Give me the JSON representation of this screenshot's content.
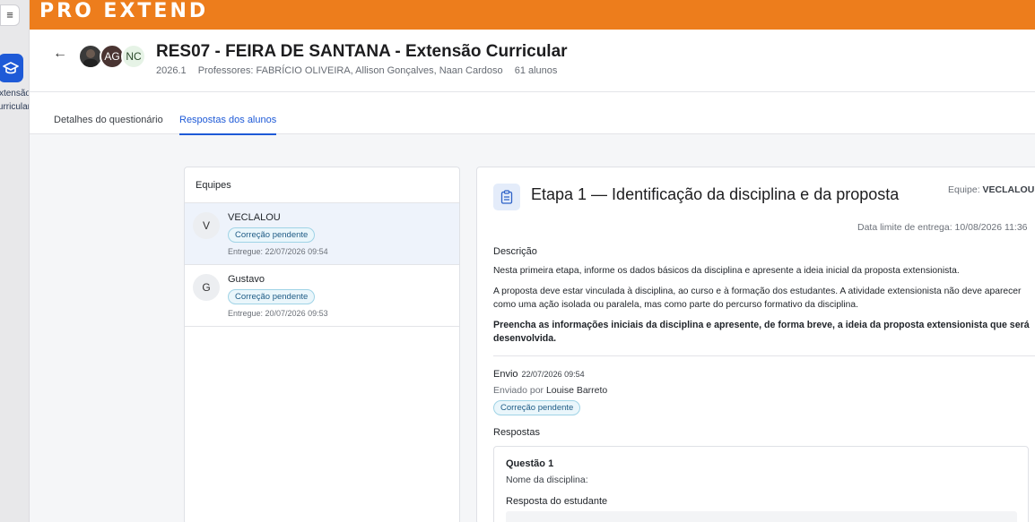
{
  "rail": {
    "menu_icon": "hamburger-icon",
    "app_icon": "graduation-cap-icon",
    "app_label": "Extensão Curricular"
  },
  "brand": {
    "logo_text": "PRO EXTEND",
    "color": "#ed7d1c"
  },
  "course": {
    "title": "RES07 - FEIRA DE SANTANA - Extensão Curricular",
    "term": "2026.1",
    "professors": "Professores: FABRÍCIO OLIVEIRA, Allison Gonçalves, Naan Cardoso",
    "students": "61 alunos",
    "avatars": [
      "",
      "AG",
      "NC"
    ]
  },
  "tabs": [
    {
      "label": "Detalhes do questionário",
      "active": false
    },
    {
      "label": "Respostas dos alunos",
      "active": true
    }
  ],
  "teams": {
    "title": "Equipes",
    "items": [
      {
        "initial": "V",
        "name": "VECLALOU",
        "status": "Correção pendente",
        "delivered": "Entregue: 22/07/2026 09:54",
        "selected": true
      },
      {
        "initial": "G",
        "name": "Gustavo",
        "status": "Correção pendente",
        "delivered": "Entregue: 20/07/2026 09:53",
        "selected": false
      }
    ]
  },
  "detail": {
    "stage_title": "Etapa 1 — Identificação da disciplina e da proposta",
    "team_label": "Equipe:",
    "team_name": "VECLALOU",
    "deadline": "Data limite de entrega: 10/08/2026 11:36",
    "description_heading": "Descrição",
    "paragraph1": "Nesta primeira etapa, informe os dados básicos da disciplina e apresente a ideia inicial da proposta extensionista.",
    "paragraph2": "A proposta deve estar vinculada à disciplina, ao curso e à formação dos estudantes. A atividade extensionista não deve aparecer como uma ação isolada ou paralela, mas como parte do percurso formativo da disciplina.",
    "paragraph3": "Preencha as informações iniciais da disciplina e apresente, de forma breve, a ideia da proposta extensionista que será desenvolvida.",
    "submission_label": "Envio",
    "submission_date": "22/07/2026 09:54",
    "sent_by_label": "Enviado por",
    "sent_by": "Louise Barreto",
    "status": "Correção pendente",
    "answers_heading": "Respostas",
    "question": {
      "title": "Questão 1",
      "text": "Nome da disciplina:",
      "answer_label": "Resposta do estudante"
    }
  },
  "colors": {
    "accent": "#1e5ad7",
    "badge_bg": "#eaf6fb",
    "badge_border": "#9fd3e6"
  }
}
